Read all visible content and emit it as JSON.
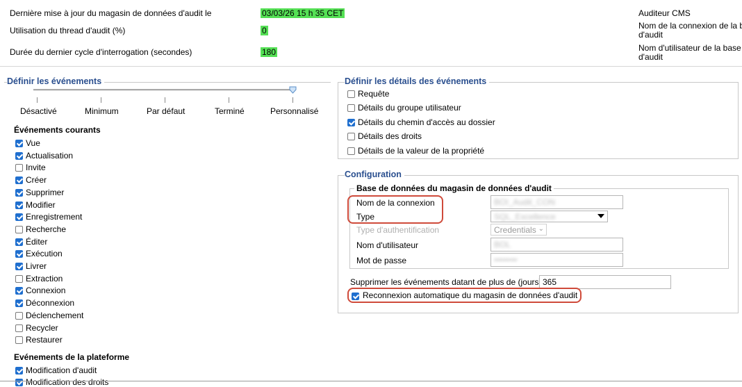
{
  "header": {
    "last_update_label": "Dernière mise à jour du magasin de données d'audit le",
    "last_update_value": "03/03/26 15 h 35 CET",
    "thread_usage_label": "Utilisation du thread d'audit (%)",
    "thread_usage_value": "0",
    "cycle_duration_label": "Durée du dernier cycle d'interrogation (secondes)",
    "cycle_duration_value": "180",
    "right_auditor_label": "Auditeur CMS",
    "right_connection_name_label_1": "Nom de la connexion de la b",
    "right_connection_name_label_2": "d'audit",
    "right_username_label_1": "Nom d'utilisateur de la base",
    "right_username_label_2": "d'audit"
  },
  "events": {
    "title": "Définir les événements",
    "slider_labels": [
      "Désactivé",
      "Minimum",
      "Par défaut",
      "Terminé",
      "Personnalisé"
    ],
    "slider_level": "Personnalisé",
    "current_title": "Événements courants",
    "current_items": [
      {
        "label": "Vue",
        "checked": true
      },
      {
        "label": "Actualisation",
        "checked": true
      },
      {
        "label": "Invite",
        "checked": false
      },
      {
        "label": "Créer",
        "checked": true
      },
      {
        "label": "Supprimer",
        "checked": true
      },
      {
        "label": "Modifier",
        "checked": true
      },
      {
        "label": "Enregistrement",
        "checked": true
      },
      {
        "label": "Recherche",
        "checked": false
      },
      {
        "label": "Éditer",
        "checked": true
      },
      {
        "label": "Exécution",
        "checked": true
      },
      {
        "label": "Livrer",
        "checked": true
      },
      {
        "label": "Extraction",
        "checked": false
      },
      {
        "label": "Connexion",
        "checked": true
      },
      {
        "label": "Déconnexion",
        "checked": true
      },
      {
        "label": "Déclenchement",
        "checked": false
      },
      {
        "label": "Recycler",
        "checked": false
      },
      {
        "label": "Restaurer",
        "checked": false
      }
    ],
    "platform_title": "Evénements de la plateforme",
    "platform_items": [
      {
        "label": "Modification d'audit",
        "checked": true
      },
      {
        "label": "Modification des droits",
        "checked": true
      }
    ]
  },
  "details": {
    "title": "Définir les détails des événements",
    "items": [
      {
        "label": "Requête",
        "checked": false
      },
      {
        "label": "Détails du groupe utilisateur",
        "checked": false
      },
      {
        "label": "Détails du chemin d'accès au dossier",
        "checked": true
      },
      {
        "label": "Détails des droits",
        "checked": false
      },
      {
        "label": "Détails de la valeur de la propriété",
        "checked": false
      }
    ]
  },
  "config": {
    "title": "Configuration",
    "db_title": "Base de données du magasin de données d'audit",
    "connection_name_label": "Nom de la connexion",
    "connection_name_value": "BOI_Audit_CON",
    "type_label": "Type",
    "type_value": "SQL_Excellence",
    "auth_type_label": "Type d'authentification",
    "auth_type_value": "Credentials",
    "username_label": "Nom d'utilisateur",
    "username_value": "BOL",
    "password_label": "Mot de passe",
    "password_value": "••••••••",
    "delete_events_label": "Supprimer les événements datant de plus de (jours)",
    "delete_events_value": "365",
    "auto_reconnect_label": "Reconnexion automatique du magasin de données d'audit",
    "auto_reconnect_checked": true
  },
  "colors": {
    "highlight": "#55e055",
    "group_title": "#2a4f8f",
    "checkbox_checked": "#1f6fcf",
    "annotation_red": "#cf4a3a"
  }
}
